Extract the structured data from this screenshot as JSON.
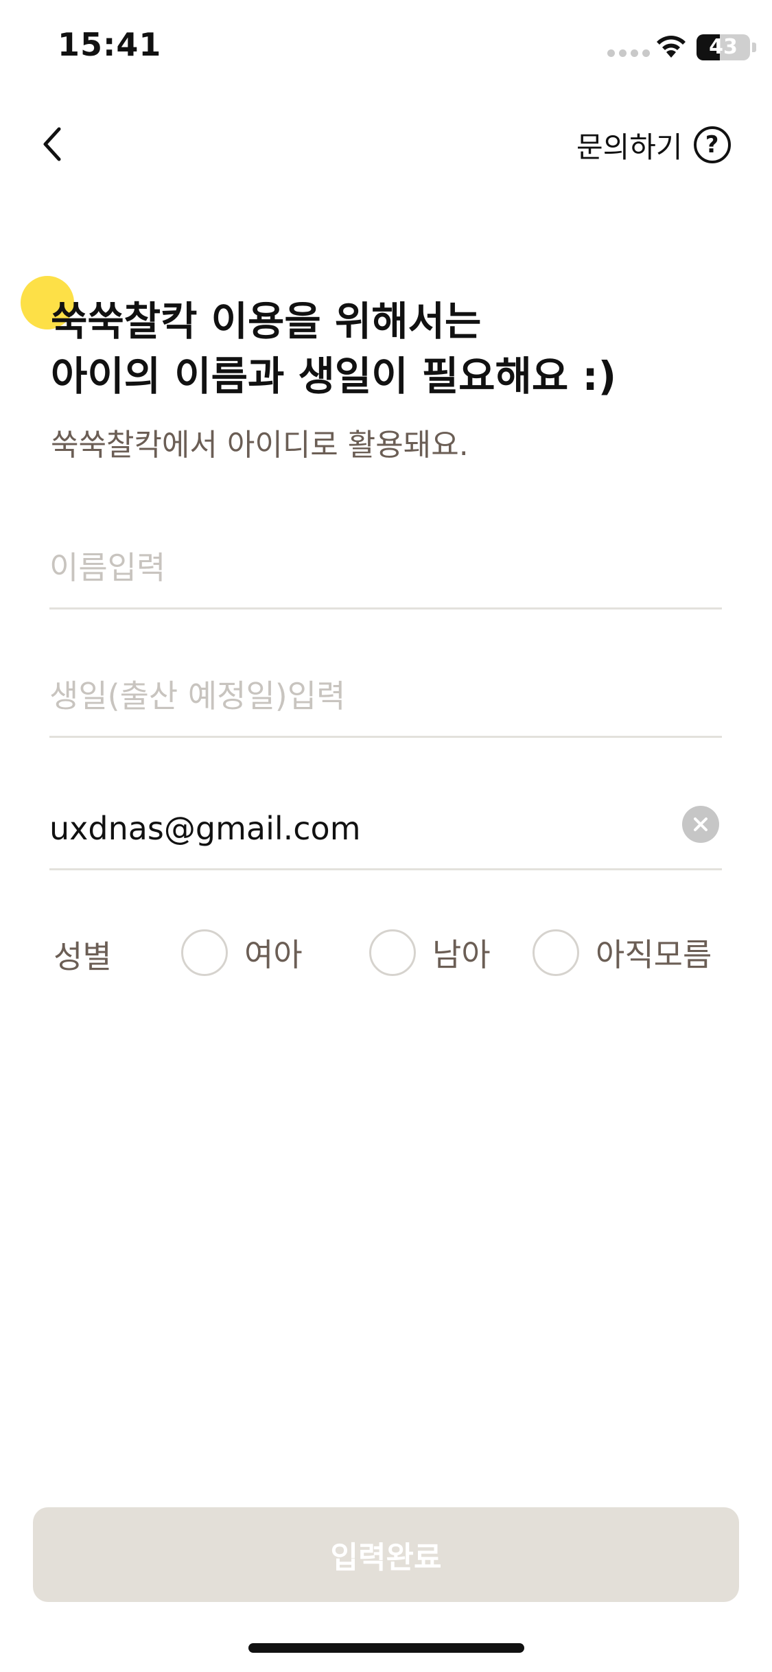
{
  "status_bar": {
    "time": "15:41",
    "battery": "43",
    "battery_level": 0.43
  },
  "nav": {
    "inquiry_label": "문의하기",
    "help_symbol": "?"
  },
  "intro": {
    "title_line1": "쑥쑥찰칵 이용을 위해서는",
    "title_line2": "아이의 이름과 생일이 필요해요 :)",
    "subtitle": "쑥쑥찰칵에서 아이디로 활용돼요."
  },
  "form": {
    "name_placeholder": "이름입력",
    "name_value": "",
    "birth_placeholder": "생일(출산 예정일)입력",
    "birth_value": "",
    "email_value": "uxdnas@gmail.com",
    "gender": {
      "label": "성별",
      "options": [
        "여아",
        "남아",
        "아직모름"
      ],
      "selected": null
    }
  },
  "submit": {
    "label": "입력완료",
    "enabled": false
  },
  "colors": {
    "accent_dot": "#fde047",
    "button_disabled_bg": "#e3dfd8",
    "secondary_text": "#6b5e55",
    "placeholder": "#c8c4bf",
    "divider": "#e3e1dc"
  },
  "icons": {
    "back": "chevron-left-icon",
    "help": "question-circle-icon",
    "clear": "clear-icon",
    "wifi": "wifi-icon",
    "signal": "signal-icon",
    "battery": "battery-icon"
  }
}
